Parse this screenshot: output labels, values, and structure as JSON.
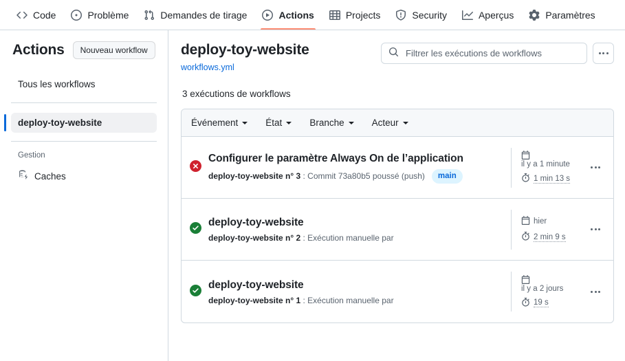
{
  "nav": {
    "tabs": [
      {
        "label": "Code",
        "icon": "code-icon",
        "active": false
      },
      {
        "label": "Problème",
        "icon": "issue-opened-icon",
        "active": false
      },
      {
        "label": "Demandes de tirage",
        "icon": "git-pull-request-icon",
        "active": false
      },
      {
        "label": "Actions",
        "icon": "play-circle-icon",
        "active": true
      },
      {
        "label": "Projects",
        "icon": "table-icon",
        "active": false
      },
      {
        "label": "Security",
        "icon": "shield-icon",
        "active": false
      },
      {
        "label": "Aperçus",
        "icon": "graph-icon",
        "active": false
      },
      {
        "label": "Paramètres",
        "icon": "gear-icon",
        "active": false
      }
    ]
  },
  "sidebar": {
    "title": "Actions",
    "new_workflow_label": "Nouveau workflow",
    "all_workflows_label": "Tous les workflows",
    "selected_workflow_label": "deploy-toy-website",
    "management_label": "Gestion",
    "caches_label": "Caches"
  },
  "main": {
    "workflow_title": "deploy-toy-website",
    "workflow_file": "workflows.yml",
    "runs_count_label": "3 exécutions de workflows",
    "search": {
      "placeholder": "Filtrer les exécutions de workflows",
      "value": ""
    },
    "filters": [
      {
        "label": "Événement"
      },
      {
        "label": "État"
      },
      {
        "label": "Branche"
      },
      {
        "label": "Acteur"
      }
    ],
    "runs": [
      {
        "status": "failure",
        "status_icon": "x-circle-fill-icon",
        "status_color": "#cf222e",
        "title": "Configurer le paramètre Always On de l’application",
        "sub_strong": "deploy-toy-website n° 3",
        "sub_rest": " : Commit 73a80b5 poussé (push)",
        "branch": "main",
        "time_ago": "il y a 1 minute",
        "duration": "1 min 13 s",
        "time_layout": "stacked"
      },
      {
        "status": "success",
        "status_icon": "check-circle-fill-icon",
        "status_color": "#1a7f37",
        "title": "deploy-toy-website",
        "sub_strong": "deploy-toy-website n° 2",
        "sub_rest": " : Exécution manuelle par",
        "branch": "",
        "time_ago": "hier",
        "duration": "2 min 9 s",
        "time_layout": "inline"
      },
      {
        "status": "success",
        "status_icon": "check-circle-fill-icon",
        "status_color": "#1a7f37",
        "title": "deploy-toy-website",
        "sub_strong": "deploy-toy-website n° 1",
        "sub_rest": " : Exécution manuelle par",
        "branch": "",
        "time_ago": "il y a 2 jours",
        "duration": "19 s",
        "time_layout": "stacked"
      }
    ]
  },
  "colors": {
    "accent": "#0969da",
    "active_tab_underline": "#fd8c73",
    "success": "#1a7f37",
    "failure": "#cf222e",
    "badge_bg": "#ddf4ff",
    "border": "#d1d9e0",
    "muted_text": "#59636e"
  }
}
